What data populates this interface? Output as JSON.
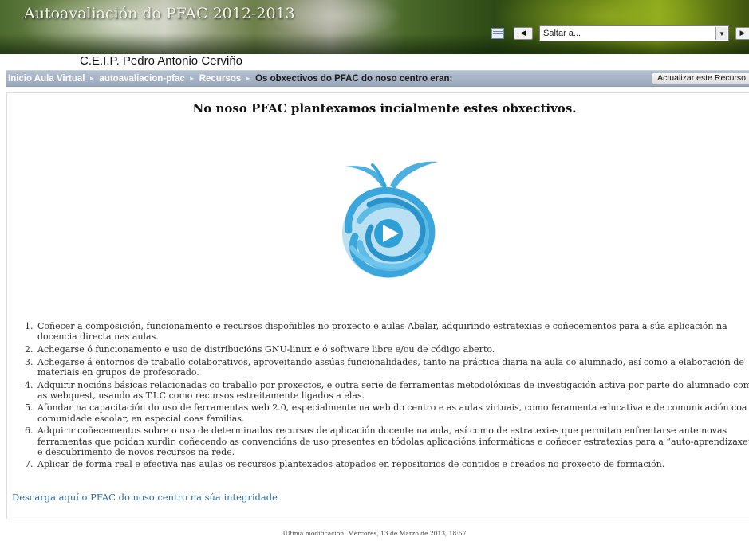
{
  "header": {
    "title": "Autoavaliación do PFAC 2012-2013",
    "jump_select": {
      "selected": "Saltar a..."
    },
    "icons": [
      "course-index-icon",
      "prev-arrow-icon",
      "dropdown-arrow-icon",
      "next-arrow-icon"
    ]
  },
  "school_name": "C.E.I.P. Pedro Antonio Cerviño",
  "breadcrumb": {
    "items": [
      {
        "label": "Inicio Aula Virtual"
      },
      {
        "label": "autoavaliacion-pfac"
      },
      {
        "label": "Recursos"
      }
    ],
    "current": "Os obxectivos do PFAC do noso centro eran:",
    "separator": "►",
    "update_button": "Actualizar este Recurso"
  },
  "content": {
    "heading": "No noso PFAC plantexamos incialmente estes obxectivos.",
    "objectives": [
      "Coñecer a composición, funcionamento e recursos dispoñibles no proxecto e aulas Abalar, adquirindo estratexias e coñecementos para a súa aplicación na docencia directa nas aulas.",
      "Achegarse ó funcionamento e uso de distribucións GNU-linux e ó software libre e/ou de código aberto.",
      "Achegarse á entornos de traballo colaborativos, aproveitando assúas funcionalidades, tanto na práctica diaria na aula co alumnado, así como a elaboración de materiais en grupos de profesorado.",
      "Adquirir nocións básicas relacionadas co traballo por proxectos, e outra serie de ferramentas metodolóxicas de investigación activa por parte do alumnado como as webquest, usando as T.I.C como recursos estreitamente ligados a elas.",
      "Afondar na capacitación do uso de ferramentas web 2.0, especialmente na web do centro e as aulas virtuais, como feramenta educativa e de comunicación coa comunidade escolar, en especial coas familias.",
      "Adquirir coñecementos sobre o uso de determinados recursos de aplicación docente na aula, así como de estratexias que permitan enfrentarse ante novas ferramentas que poidan xurdir, coñecendo as convencións de uso presentes en tódolas aplicacións informáticas e coñecer estratexias para a “auto-aprendizaxe” e descubrimento de novos recursos na rede.",
      "Aplicar de forma real e efectiva nas aulas os recursos plantexados atopados en repositorios de contidos e creados no proxecto de formación."
    ],
    "download_link": "Descarga aquí o PFAC do noso centro na súa integridade",
    "logo": {
      "icon": "abalar-apple-logo",
      "color": "#3aa6dc"
    }
  },
  "footer": "Última modificación: Mércores, 13 de Marzo de 2013, 18:57",
  "colors": {
    "breadcrumb_bar": "#a6b2c4",
    "link": "#2f6a96",
    "logo_blue": "#3aa6dc"
  }
}
